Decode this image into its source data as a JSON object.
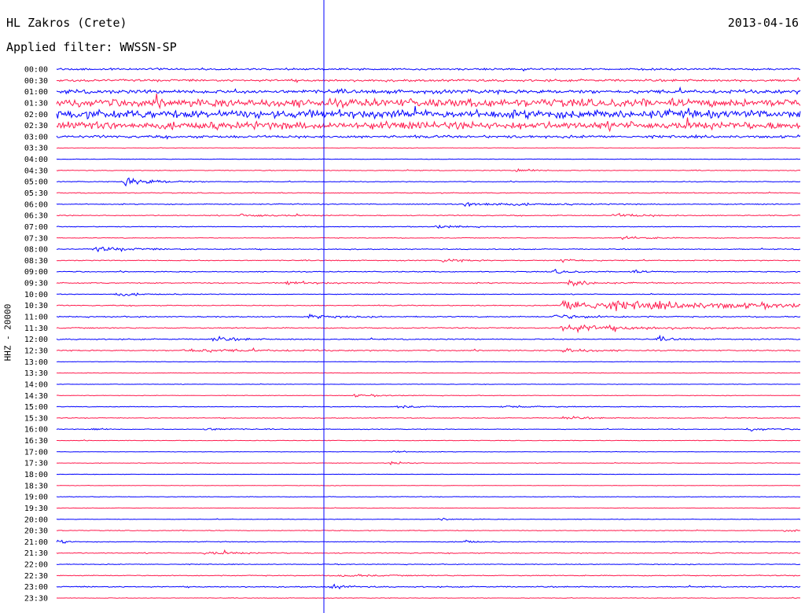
{
  "header": {
    "station": "HL Zakros (Crete)",
    "filter": "Applied filter: WWSSN-SP",
    "date": "2013-04-16"
  },
  "axis": {
    "ylabel": "HHZ - 20000"
  },
  "chart_data": {
    "type": "line",
    "title": "HL Zakros (Crete)",
    "subtitle": "Applied filter: WWSSN-SP",
    "date": "2013-04-16",
    "ylabel": "HHZ - 20000",
    "grid": false,
    "series_colors": [
      "#0000ff",
      "#ff1a4d"
    ],
    "marker_color": "#0000ff",
    "rows": [
      {
        "label": "00:00",
        "color": "#0000ff",
        "amp": 0.5,
        "events": []
      },
      {
        "label": "00:30",
        "color": "#ff1a4d",
        "amp": 0.6,
        "events": []
      },
      {
        "label": "01:00",
        "color": "#0000ff",
        "amp": 1.0,
        "events": []
      },
      {
        "label": "01:30",
        "color": "#ff1a4d",
        "amp": 2.2,
        "events": []
      },
      {
        "label": "02:00",
        "color": "#0000ff",
        "amp": 2.2,
        "events": []
      },
      {
        "label": "02:30",
        "color": "#ff1a4d",
        "amp": 2.0,
        "events": []
      },
      {
        "label": "03:00",
        "color": "#0000ff",
        "amp": 0.7,
        "events": []
      },
      {
        "label": "03:30",
        "color": "#ff1a4d",
        "amp": 0.15,
        "events": []
      },
      {
        "label": "04:00",
        "color": "#0000ff",
        "amp": 0.15,
        "events": []
      },
      {
        "label": "04:30",
        "color": "#ff1a4d",
        "amp": 0.2,
        "events": [
          [
            0.62,
            1.2,
            0.02
          ]
        ]
      },
      {
        "label": "05:00",
        "color": "#0000ff",
        "amp": 0.2,
        "events": [
          [
            0.09,
            2.4,
            0.04
          ]
        ]
      },
      {
        "label": "05:30",
        "color": "#ff1a4d",
        "amp": 0.25,
        "events": []
      },
      {
        "label": "06:00",
        "color": "#0000ff",
        "amp": 0.25,
        "events": [
          [
            0.55,
            1.2,
            0.07
          ]
        ]
      },
      {
        "label": "06:30",
        "color": "#ff1a4d",
        "amp": 0.25,
        "events": [
          [
            0.25,
            0.9,
            0.04
          ],
          [
            0.75,
            1.0,
            0.04
          ]
        ]
      },
      {
        "label": "07:00",
        "color": "#0000ff",
        "amp": 0.2,
        "events": [
          [
            0.51,
            0.9,
            0.03
          ]
        ]
      },
      {
        "label": "07:30",
        "color": "#ff1a4d",
        "amp": 0.2,
        "events": [
          [
            0.76,
            0.8,
            0.04
          ]
        ]
      },
      {
        "label": "08:00",
        "color": "#0000ff",
        "amp": 0.25,
        "events": [
          [
            0.05,
            1.3,
            0.05
          ]
        ]
      },
      {
        "label": "08:30",
        "color": "#ff1a4d",
        "amp": 0.25,
        "events": [
          [
            0.52,
            0.8,
            0.03
          ],
          [
            0.68,
            1.6,
            0.02
          ]
        ]
      },
      {
        "label": "09:00",
        "color": "#0000ff",
        "amp": 0.25,
        "events": [
          [
            0.67,
            1.2,
            0.02
          ],
          [
            0.77,
            0.9,
            0.02
          ]
        ]
      },
      {
        "label": "09:30",
        "color": "#ff1a4d",
        "amp": 0.3,
        "events": [
          [
            0.31,
            1.0,
            0.03
          ],
          [
            0.69,
            2.6,
            0.02
          ]
        ]
      },
      {
        "label": "10:00",
        "color": "#0000ff",
        "amp": 0.2,
        "events": [
          [
            0.08,
            1.1,
            0.03
          ]
        ]
      },
      {
        "label": "10:30",
        "color": "#ff1a4d",
        "amp": 0.25,
        "events": [
          [
            0.68,
            3.0,
            0.28
          ]
        ]
      },
      {
        "label": "11:00",
        "color": "#0000ff",
        "amp": 0.3,
        "events": [
          [
            0.34,
            1.1,
            0.03
          ],
          [
            0.67,
            1.2,
            0.05
          ]
        ]
      },
      {
        "label": "11:30",
        "color": "#ff1a4d",
        "amp": 0.3,
        "events": [
          [
            0.68,
            2.2,
            0.08
          ]
        ]
      },
      {
        "label": "12:00",
        "color": "#0000ff",
        "amp": 0.3,
        "events": [
          [
            0.21,
            1.3,
            0.03
          ],
          [
            0.81,
            1.0,
            0.02
          ]
        ]
      },
      {
        "label": "12:30",
        "color": "#ff1a4d",
        "amp": 0.3,
        "events": [
          [
            0.17,
            1.0,
            0.08
          ],
          [
            0.68,
            1.5,
            0.03
          ]
        ]
      },
      {
        "label": "13:00",
        "color": "#0000ff",
        "amp": 0.15,
        "events": []
      },
      {
        "label": "13:30",
        "color": "#ff1a4d",
        "amp": 0.15,
        "events": []
      },
      {
        "label": "14:00",
        "color": "#0000ff",
        "amp": 0.12,
        "events": []
      },
      {
        "label": "14:30",
        "color": "#ff1a4d",
        "amp": 0.15,
        "events": [
          [
            0.4,
            0.6,
            0.04
          ]
        ]
      },
      {
        "label": "15:00",
        "color": "#0000ff",
        "amp": 0.2,
        "events": [
          [
            0.46,
            0.9,
            0.02
          ],
          [
            0.6,
            0.8,
            0.04
          ]
        ]
      },
      {
        "label": "15:30",
        "color": "#ff1a4d",
        "amp": 0.2,
        "events": [
          [
            0.68,
            0.9,
            0.03
          ]
        ]
      },
      {
        "label": "16:00",
        "color": "#0000ff",
        "amp": 0.2,
        "events": [
          [
            0.05,
            1.3,
            0.01
          ],
          [
            0.2,
            0.8,
            0.03
          ],
          [
            0.93,
            0.9,
            0.03
          ]
        ]
      },
      {
        "label": "16:30",
        "color": "#ff1a4d",
        "amp": 0.15,
        "events": []
      },
      {
        "label": "17:00",
        "color": "#0000ff",
        "amp": 0.12,
        "events": [
          [
            0.45,
            0.7,
            0.02
          ]
        ]
      },
      {
        "label": "17:30",
        "color": "#ff1a4d",
        "amp": 0.15,
        "events": [
          [
            0.45,
            0.9,
            0.02
          ]
        ]
      },
      {
        "label": "18:00",
        "color": "#0000ff",
        "amp": 0.1,
        "events": []
      },
      {
        "label": "18:30",
        "color": "#ff1a4d",
        "amp": 0.12,
        "events": []
      },
      {
        "label": "19:00",
        "color": "#0000ff",
        "amp": 0.15,
        "events": []
      },
      {
        "label": "19:30",
        "color": "#ff1a4d",
        "amp": 0.12,
        "events": []
      },
      {
        "label": "20:00",
        "color": "#0000ff",
        "amp": 0.15,
        "events": [
          [
            0.52,
            0.6,
            0.02
          ]
        ]
      },
      {
        "label": "20:30",
        "color": "#ff1a4d",
        "amp": 0.2,
        "events": [
          [
            0.98,
            0.8,
            0.01
          ]
        ]
      },
      {
        "label": "21:00",
        "color": "#0000ff",
        "amp": 0.2,
        "events": [
          [
            0.0,
            1.5,
            0.01
          ],
          [
            0.55,
            1.5,
            0.01
          ]
        ]
      },
      {
        "label": "21:30",
        "color": "#ff1a4d",
        "amp": 0.25,
        "events": [
          [
            0.2,
            0.8,
            0.04
          ]
        ]
      },
      {
        "label": "22:00",
        "color": "#0000ff",
        "amp": 0.2,
        "events": []
      },
      {
        "label": "22:30",
        "color": "#ff1a4d",
        "amp": 0.25,
        "events": [
          [
            0.38,
            0.8,
            0.04
          ]
        ]
      },
      {
        "label": "23:00",
        "color": "#0000ff",
        "amp": 0.3,
        "events": [
          [
            0.37,
            1.2,
            0.02
          ]
        ]
      },
      {
        "label": "23:30",
        "color": "#ff1a4d",
        "amp": 0.15,
        "events": []
      }
    ]
  }
}
